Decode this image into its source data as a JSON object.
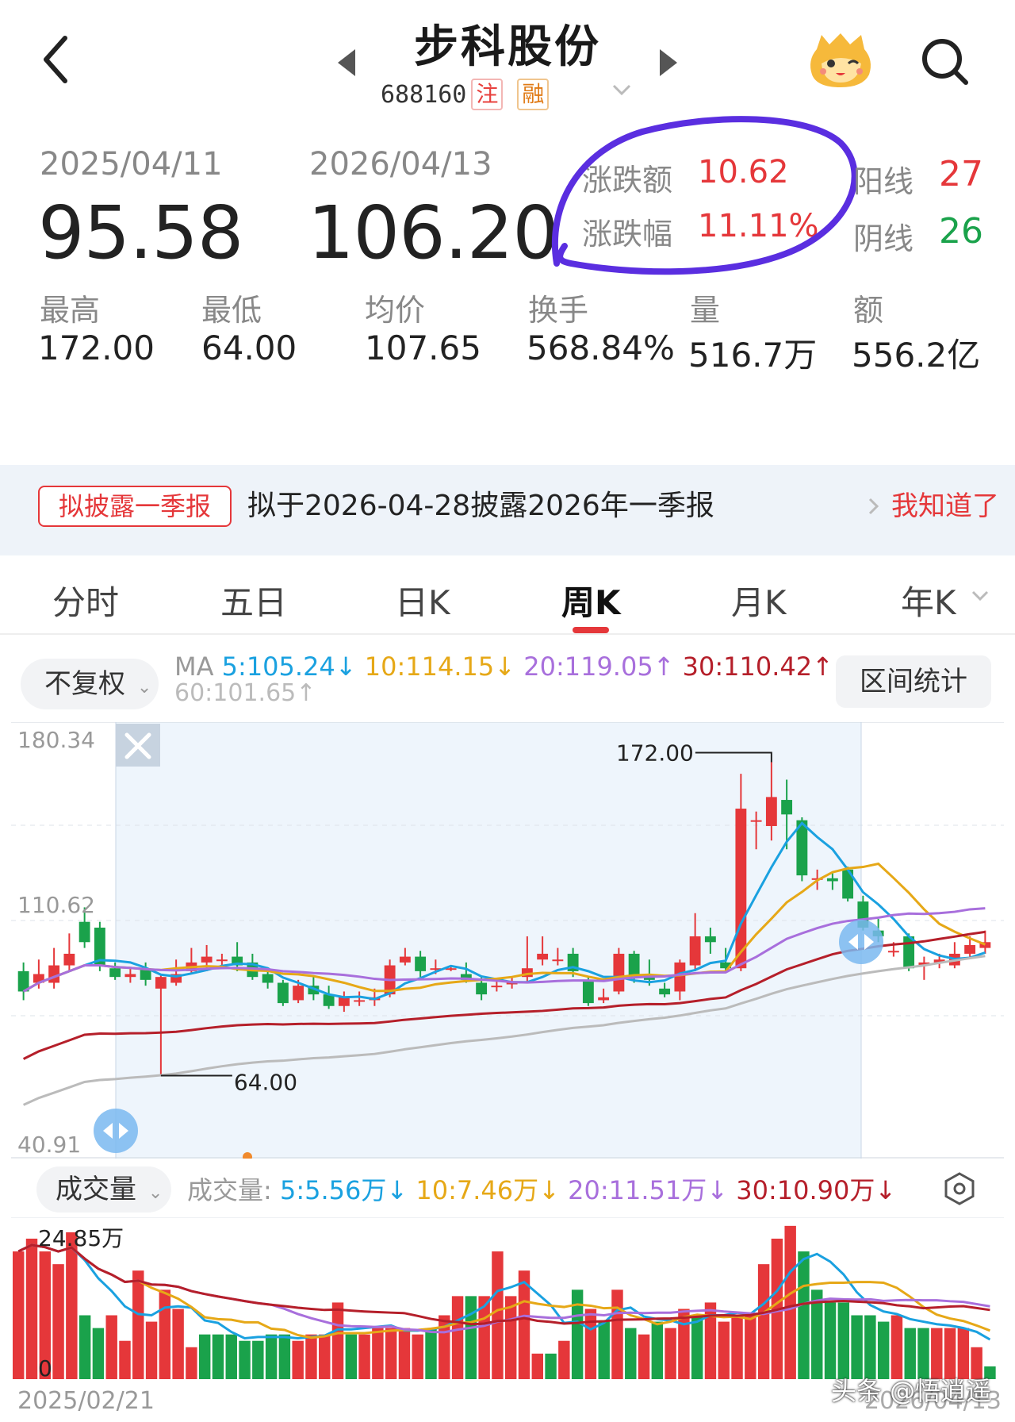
{
  "header": {
    "title": "步科股份",
    "code": "688160",
    "tag_registration": "注",
    "tag_margin": "融"
  },
  "summary": {
    "start_date": "2025/04/11",
    "end_date": "2026/04/13",
    "start_price": "95.58",
    "end_price": "106.20",
    "change_amount_label": "涨跌额",
    "change_amount": "10.62",
    "change_pct_label": "涨跌幅",
    "change_pct": "11.11%",
    "yang_label": "阳线",
    "yang_count": "27",
    "yin_label": "阴线",
    "yin_count": "26",
    "stats": [
      {
        "label": "最高",
        "value": "172.00"
      },
      {
        "label": "最低",
        "value": "64.00"
      },
      {
        "label": "均价",
        "value": "107.65"
      },
      {
        "label": "换手",
        "value": "568.84%"
      },
      {
        "label": "量",
        "value": "516.7万"
      },
      {
        "label": "额",
        "value": "556.2亿"
      }
    ]
  },
  "banner": {
    "tag": "拟披露一季报",
    "text": "拟于2026-04-28披露2026年一季报",
    "action": "我知道了"
  },
  "tabs": [
    "分时",
    "五日",
    "日K",
    "周K",
    "月K",
    "年K"
  ],
  "active_tab": "周K",
  "toolbar": {
    "adjust": "不复权",
    "ma_label": "MA",
    "ma5": "5:105.24↓",
    "ma10": "10:114.15↓",
    "ma20": "20:119.05↑",
    "ma30": "30:110.42↑",
    "ma60": "60:101.65↑",
    "range_stats": "区间统计"
  },
  "kline": {
    "axis_top": "180.34",
    "axis_mid": "110.62",
    "axis_bottom": "40.91",
    "high_label": "172.00",
    "low_label": "64.00"
  },
  "volume": {
    "selector": "成交量",
    "label": "成交量:",
    "ma5": "5:5.56万↓",
    "ma10": "10:7.46万↓",
    "ma20": "20:11.51万↓",
    "ma30": "30:10.90万↓",
    "axis_top": "24.85万",
    "axis_zero": "0"
  },
  "axis_dates": {
    "start": "2025/02/21",
    "end": "2026/04/13"
  },
  "watermark": "头条 @悟逍遥",
  "colors": {
    "up": "#e5373a",
    "down": "#1aa24b",
    "ma5": "#1aa1e0",
    "ma10": "#e6a817",
    "ma20": "#a86fdc",
    "ma30": "#b51f2a",
    "ma60": "#bbbbbb",
    "highlight": "#eef5fc",
    "annotation": "#5a2ee0"
  },
  "chart_data": {
    "type": "candlestick",
    "ylim": [
      40.91,
      180.34
    ],
    "candles": [
      {
        "o": 100,
        "c": 93,
        "h": 103,
        "l": 90
      },
      {
        "o": 96,
        "c": 99,
        "h": 104,
        "l": 94
      },
      {
        "o": 96,
        "c": 102,
        "h": 108,
        "l": 94
      },
      {
        "o": 102,
        "c": 106,
        "h": 113,
        "l": 100
      },
      {
        "o": 117,
        "c": 110,
        "h": 122,
        "l": 108
      },
      {
        "o": 115,
        "c": 102,
        "h": 117,
        "l": 100
      },
      {
        "o": 101,
        "c": 98,
        "h": 103,
        "l": 97
      },
      {
        "o": 98,
        "c": 99,
        "h": 101,
        "l": 96
      },
      {
        "o": 101,
        "c": 97,
        "h": 103,
        "l": 95
      },
      {
        "o": 94,
        "c": 98,
        "h": 99,
        "l": 64
      },
      {
        "o": 96,
        "c": 99,
        "h": 104,
        "l": 95
      },
      {
        "o": 100,
        "c": 103,
        "h": 108,
        "l": 99
      },
      {
        "o": 103,
        "c": 105,
        "h": 109,
        "l": 100
      },
      {
        "o": 104,
        "c": 104,
        "h": 106,
        "l": 102
      },
      {
        "o": 105,
        "c": 102,
        "h": 110,
        "l": 100
      },
      {
        "o": 103,
        "c": 98,
        "h": 106,
        "l": 97
      },
      {
        "o": 99,
        "c": 96,
        "h": 100,
        "l": 94
      },
      {
        "o": 96,
        "c": 89,
        "h": 97,
        "l": 88
      },
      {
        "o": 90,
        "c": 95,
        "h": 97,
        "l": 89
      },
      {
        "o": 95,
        "c": 92,
        "h": 98,
        "l": 90
      },
      {
        "o": 92,
        "c": 88,
        "h": 95,
        "l": 87
      },
      {
        "o": 88,
        "c": 91,
        "h": 93,
        "l": 86
      },
      {
        "o": 90,
        "c": 90,
        "h": 93,
        "l": 88
      },
      {
        "o": 90,
        "c": 91,
        "h": 94,
        "l": 88
      },
      {
        "o": 92,
        "c": 102,
        "h": 104,
        "l": 91
      },
      {
        "o": 103,
        "c": 105,
        "h": 108,
        "l": 102
      },
      {
        "o": 105,
        "c": 100,
        "h": 107,
        "l": 98
      },
      {
        "o": 101,
        "c": 101,
        "h": 104,
        "l": 99
      },
      {
        "o": 101,
        "c": 101,
        "h": 102,
        "l": 100
      },
      {
        "o": 99,
        "c": 97,
        "h": 103,
        "l": 96
      },
      {
        "o": 96,
        "c": 92,
        "h": 98,
        "l": 90
      },
      {
        "o": 95,
        "c": 95,
        "h": 97,
        "l": 93
      },
      {
        "o": 96,
        "c": 96,
        "h": 98,
        "l": 94
      },
      {
        "o": 98,
        "c": 101,
        "h": 112,
        "l": 96
      },
      {
        "o": 104,
        "c": 106,
        "h": 112,
        "l": 102
      },
      {
        "o": 104,
        "c": 104,
        "h": 108,
        "l": 102
      },
      {
        "o": 106,
        "c": 100,
        "h": 108,
        "l": 98
      },
      {
        "o": 97,
        "c": 89,
        "h": 98,
        "l": 88
      },
      {
        "o": 90,
        "c": 91,
        "h": 94,
        "l": 89
      },
      {
        "o": 93,
        "c": 106,
        "h": 108,
        "l": 92
      },
      {
        "o": 106,
        "c": 98,
        "h": 107,
        "l": 96
      },
      {
        "o": 99,
        "c": 97,
        "h": 104,
        "l": 95
      },
      {
        "o": 94,
        "c": 92,
        "h": 96,
        "l": 91
      },
      {
        "o": 93,
        "c": 103,
        "h": 104,
        "l": 90
      },
      {
        "o": 102,
        "c": 112,
        "h": 120,
        "l": 100
      },
      {
        "o": 112,
        "c": 110,
        "h": 115,
        "l": 106
      },
      {
        "o": 103,
        "c": 101,
        "h": 108,
        "l": 100
      },
      {
        "o": 101,
        "c": 156,
        "h": 168,
        "l": 100
      },
      {
        "o": 152,
        "c": 152,
        "h": 155,
        "l": 142
      },
      {
        "o": 150,
        "c": 160,
        "h": 172,
        "l": 145
      },
      {
        "o": 159,
        "c": 154,
        "h": 166,
        "l": 142
      },
      {
        "o": 152,
        "c": 133,
        "h": 153,
        "l": 131
      },
      {
        "o": 132,
        "c": 132,
        "h": 135,
        "l": 128
      },
      {
        "o": 132,
        "c": 131,
        "h": 134,
        "l": 128
      },
      {
        "o": 135,
        "c": 125,
        "h": 136,
        "l": 124
      },
      {
        "o": 124,
        "c": 115,
        "h": 126,
        "l": 114
      },
      {
        "o": 114,
        "c": 112,
        "h": 118,
        "l": 110
      },
      {
        "o": 107,
        "c": 107,
        "h": 110,
        "l": 105
      },
      {
        "o": 112,
        "c": 101,
        "h": 113,
        "l": 100
      },
      {
        "o": 102,
        "c": 103,
        "h": 105,
        "l": 97
      },
      {
        "o": 103,
        "c": 104,
        "h": 106,
        "l": 101
      },
      {
        "o": 102,
        "c": 106,
        "h": 110,
        "l": 101
      },
      {
        "o": 106,
        "c": 109,
        "h": 112,
        "l": 105
      },
      {
        "o": 108,
        "c": 110,
        "h": 114,
        "l": 106
      }
    ],
    "volume_ylim": [
      0,
      24.85
    ],
    "volume": [
      {
        "v": 20,
        "up": 1
      },
      {
        "v": 22,
        "up": 1
      },
      {
        "v": 20,
        "up": 1
      },
      {
        "v": 18,
        "up": 1
      },
      {
        "v": 23,
        "up": 1
      },
      {
        "v": 10,
        "up": 0
      },
      {
        "v": 8,
        "up": 0
      },
      {
        "v": 10,
        "up": 1
      },
      {
        "v": 6,
        "up": 1
      },
      {
        "v": 17,
        "up": 1
      },
      {
        "v": 9,
        "up": 1
      },
      {
        "v": 14,
        "up": 1
      },
      {
        "v": 11,
        "up": 1
      },
      {
        "v": 5,
        "up": 1
      },
      {
        "v": 7,
        "up": 0
      },
      {
        "v": 7,
        "up": 0
      },
      {
        "v": 7,
        "up": 0
      },
      {
        "v": 6,
        "up": 0
      },
      {
        "v": 6,
        "up": 0
      },
      {
        "v": 7,
        "up": 0
      },
      {
        "v": 7,
        "up": 0
      },
      {
        "v": 6,
        "up": 1
      },
      {
        "v": 7,
        "up": 1
      },
      {
        "v": 7,
        "up": 1
      },
      {
        "v": 12,
        "up": 1
      },
      {
        "v": 7,
        "up": 0
      },
      {
        "v": 7,
        "up": 1
      },
      {
        "v": 8,
        "up": 1
      },
      {
        "v": 8,
        "up": 1
      },
      {
        "v": 8,
        "up": 1
      },
      {
        "v": 7,
        "up": 1
      },
      {
        "v": 8,
        "up": 0
      },
      {
        "v": 10,
        "up": 1
      },
      {
        "v": 13,
        "up": 1
      },
      {
        "v": 13,
        "up": 0
      },
      {
        "v": 13,
        "up": 1
      },
      {
        "v": 20,
        "up": 1
      },
      {
        "v": 13,
        "up": 1
      },
      {
        "v": 17,
        "up": 1
      },
      {
        "v": 4,
        "up": 1
      },
      {
        "v": 4,
        "up": 0
      },
      {
        "v": 6,
        "up": 1
      },
      {
        "v": 14,
        "up": 0
      },
      {
        "v": 11,
        "up": 1
      },
      {
        "v": 9,
        "up": 0
      },
      {
        "v": 14,
        "up": 1
      },
      {
        "v": 8,
        "up": 0
      },
      {
        "v": 7,
        "up": 1
      },
      {
        "v": 9,
        "up": 0
      },
      {
        "v": 8,
        "up": 1
      },
      {
        "v": 11,
        "up": 1
      },
      {
        "v": 10,
        "up": 0
      },
      {
        "v": 12,
        "up": 1
      },
      {
        "v": 9,
        "up": 1
      },
      {
        "v": 10,
        "up": 1
      },
      {
        "v": 10,
        "up": 1
      },
      {
        "v": 18,
        "up": 1
      },
      {
        "v": 22,
        "up": 1
      },
      {
        "v": 24,
        "up": 1
      },
      {
        "v": 20,
        "up": 0
      },
      {
        "v": 14,
        "up": 0
      },
      {
        "v": 12,
        "up": 0
      },
      {
        "v": 12,
        "up": 0
      },
      {
        "v": 10,
        "up": 0
      },
      {
        "v": 10,
        "up": 0
      },
      {
        "v": 9,
        "up": 0
      },
      {
        "v": 10,
        "up": 1
      },
      {
        "v": 8,
        "up": 0
      },
      {
        "v": 8,
        "up": 0
      },
      {
        "v": 8,
        "up": 1
      },
      {
        "v": 8,
        "up": 1
      },
      {
        "v": 8,
        "up": 1
      },
      {
        "v": 5,
        "up": 1
      },
      {
        "v": 2,
        "up": 0
      }
    ]
  }
}
